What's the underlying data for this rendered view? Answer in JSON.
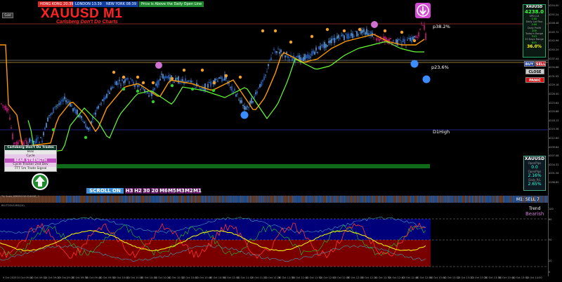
{
  "sessions": [
    {
      "label": "HONG KONG 20:39",
      "color": "#d92a2a"
    },
    {
      "label": "LONDON 13:39",
      "color": "#0f3ea0"
    },
    {
      "label": "NEW YORK 08:39",
      "color": "#0f3ea0"
    },
    {
      "label": "Price is Above the Daily Open Line",
      "color": "#1e8a2e"
    }
  ],
  "corner_tag": "Gold",
  "title": "XAUUSD M1",
  "subtitle": "Carlsberg Don't Do Charts",
  "levels": {
    "p382": "p38.2%",
    "p236": "p23.6%",
    "d1high": "D1High"
  },
  "info_panel": {
    "symbol": "XAUUSD",
    "price": "4238.0",
    "spread": "SPD:1.8",
    "lines": [
      "1.00",
      "Daily Lot Pips",
      "2.00",
      "Daily Profit",
      "200",
      "Today's Range",
      "513",
      "20 Days Range",
      "853"
    ],
    "pct": "36.0%"
  },
  "buttons": {
    "buy": "BUY",
    "sell": "SELL",
    "close": "CLOSE",
    "panic": "PANIC"
  },
  "left_box": {
    "header": "Carlsberg Don't Do Trades",
    "rows": [
      "Bias",
      "Cycle",
      "BEAR STRENGTH",
      "Cycle Tracker 2nd Dev",
      "TTT 5m Trade Signal"
    ]
  },
  "mini_panel": {
    "symbol": "XAUUSD",
    "lines": [
      "OpenPips",
      "0.0",
      "OpenPips",
      "2.16%",
      "Daily P/L",
      "2.65%"
    ]
  },
  "scroll_bar": {
    "scroll_label": "SCROLL ON",
    "timeframes": [
      "H3",
      "H2",
      "30",
      "20",
      "M6",
      "M5",
      "M3",
      "M2",
      "M1"
    ]
  },
  "sub1": {
    "label": "Tic Scale_EMBMOOEX24H2R_3",
    "signal": "M1: SELL 7"
  },
  "sub2": {
    "label": "RSI TOOLS-RSI(14)",
    "trend_title": "Trend",
    "trend_value": "Bearish"
  },
  "time_axis": [
    "9 Oct 2025",
    "10 Oct 09:04",
    "10 Oct 09:12",
    "10 Oct 09:20",
    "10 Oct 09:28",
    "10 Oct 09:36",
    "10 Oct 09:44",
    "10 Oct 09:52",
    "10 Oct 10:00",
    "10 Oct 10:08",
    "10 Oct 10:16",
    "10 Oct 10:24",
    "10 Oct 10:32",
    "10 Oct 10:40",
    "10 Oct 10:48",
    "10 Oct 10:56",
    "10 Oct 11:04",
    "10 Oct 11:12",
    "10 Oct 11:20",
    "10 Oct 11:28",
    "10 Oct 11:36",
    "10 Oct 11:44",
    "10 Oct 11:52",
    "10 Oct 12:00",
    "10 Oct 12:08",
    "10 Oct 12:16",
    "10 Oct 12:24",
    "10 Oct 12:32",
    "10 Oct 12:40",
    "10 Oct 12:48",
    "10 Oct 12:56",
    "10 Oct 13:04",
    "10 Oct 13:12",
    "10 Oct 13:20",
    "10 Oct 13:28",
    "10 Oct 13:36",
    "10 Oct 13:44",
    "10 Oct 13:52",
    "10 Oct 14:00"
  ],
  "price_axis": [
    "4254.00",
    "4251.24",
    "4248.48",
    "4245.72",
    "4242.96",
    "4240.20",
    "4237.44",
    "4234.68",
    "4231.92",
    "4229.16",
    "4226.40",
    "4223.64",
    "4220.88",
    "4218.12",
    "4215.36",
    "4212.60",
    "4209.84",
    "4207.08",
    "4204.32",
    "4201.56",
    "4198.80"
  ],
  "rsi_axis": [
    "100",
    "80",
    "50",
    "20",
    "0"
  ]
}
